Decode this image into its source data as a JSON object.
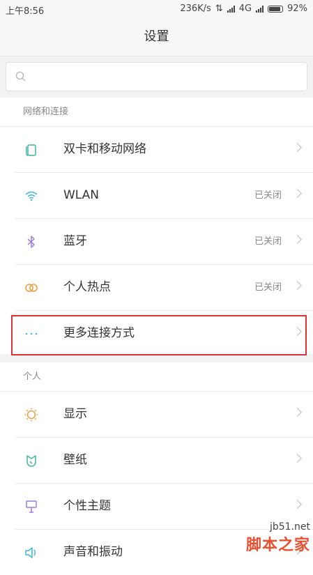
{
  "status": {
    "time": "上午8:56",
    "speed": "236K/s",
    "network": "4G",
    "battery": "92%",
    "battery_level": 0.92
  },
  "title": "设置",
  "search": {
    "placeholder": ""
  },
  "network_section": {
    "title": "网络和连接",
    "items": [
      {
        "label": "双卡和移动网络",
        "status": "",
        "icon": "sim-icon",
        "color": "#3fb99a"
      },
      {
        "label": "WLAN",
        "status": "已关闭",
        "icon": "wifi-icon",
        "color": "#3fb5d9"
      },
      {
        "label": "蓝牙",
        "status": "已关闭",
        "icon": "bluetooth-icon",
        "color": "#9a7be0"
      },
      {
        "label": "个人热点",
        "status": "已关闭",
        "icon": "hotspot-icon",
        "color": "#f39a3c"
      },
      {
        "label": "更多连接方式",
        "status": "",
        "icon": "more-icon",
        "color": "#3fb5d9"
      }
    ]
  },
  "personal_section": {
    "title": "个人",
    "items": [
      {
        "label": "显示",
        "icon": "sun-icon",
        "color": "#f39a3c"
      },
      {
        "label": "壁纸",
        "icon": "wallpaper-icon",
        "color": "#3fb99a"
      },
      {
        "label": "个性主题",
        "icon": "theme-icon",
        "color": "#9a7be0"
      },
      {
        "label": "声音和振动",
        "icon": "sound-icon",
        "color": "#3fb5d9"
      }
    ]
  },
  "watermark": {
    "domain": "jb51.net",
    "name": "脚本之家"
  }
}
